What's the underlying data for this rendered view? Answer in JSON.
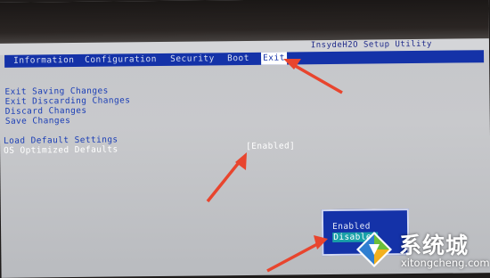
{
  "title": "InsydeH2O Setup Utility",
  "menu": [
    {
      "label": "Information",
      "active": false
    },
    {
      "label": "Configuration",
      "active": false
    },
    {
      "label": "Security",
      "active": false
    },
    {
      "label": "Boot",
      "active": false
    },
    {
      "label": "Exit",
      "active": true
    }
  ],
  "exit_options": [
    "Exit Saving Changes",
    "Exit Discarding Changes",
    "Discard Changes",
    "Save Changes"
  ],
  "default_options": [
    "Load Default Settings",
    "OS Optimized Defaults"
  ],
  "os_optimized_value": "[Enabled]",
  "popup": {
    "options": [
      "Enabled",
      "Disabled"
    ],
    "selected": "Disabled"
  },
  "watermark": {
    "text": "系统城",
    "url": "xitongcheng.com"
  },
  "colors": {
    "menu_bar": "#1432a8",
    "option_text": "#1c3fb6",
    "arrow": "#e8452e",
    "highlight": "#19a0a8"
  }
}
